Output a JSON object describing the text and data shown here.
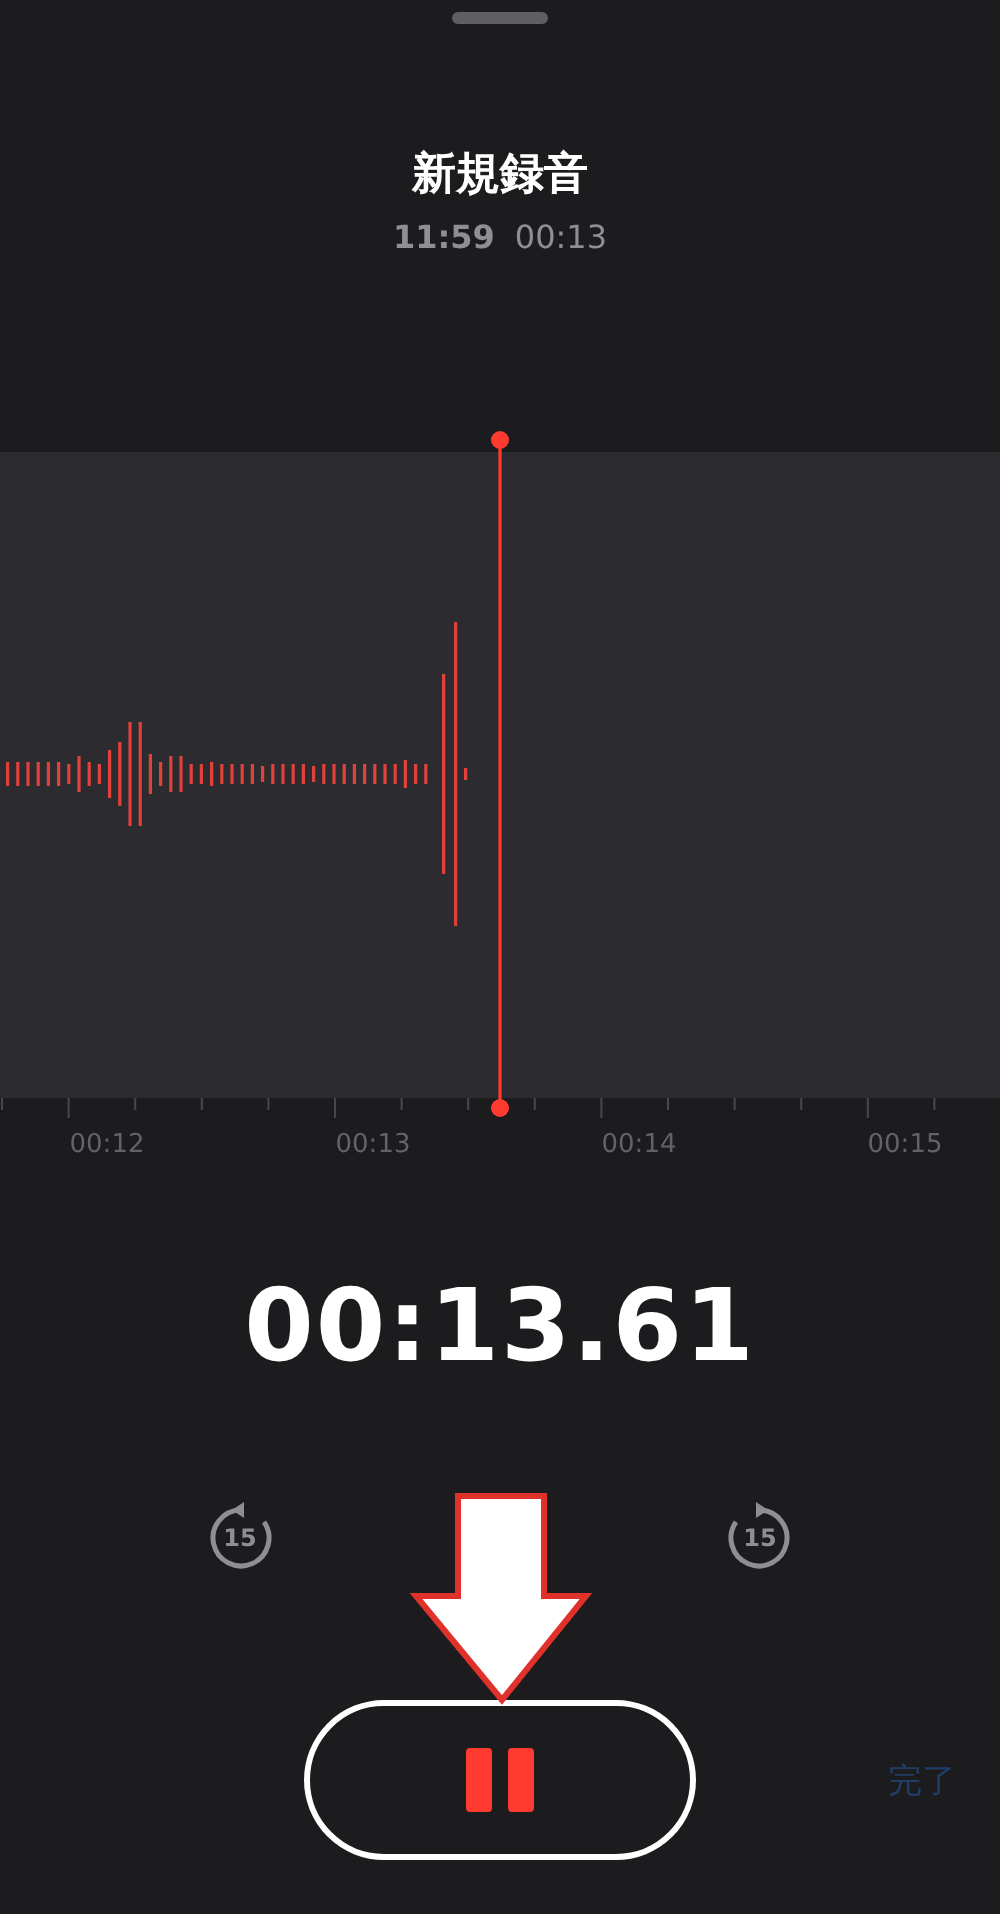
{
  "title": "新規録音",
  "subtitle": {
    "time": "11:59",
    "duration": "00:13"
  },
  "timeline": {
    "labels": [
      "00:12",
      "00:13",
      "00:14",
      "00:15"
    ]
  },
  "elapsed": "00:13.61",
  "skip_back": {
    "label": "15"
  },
  "skip_forward": {
    "label": "15"
  },
  "pause_button": {
    "kind": "pause"
  },
  "done_button": {
    "label": "完了",
    "disabled": true
  }
}
